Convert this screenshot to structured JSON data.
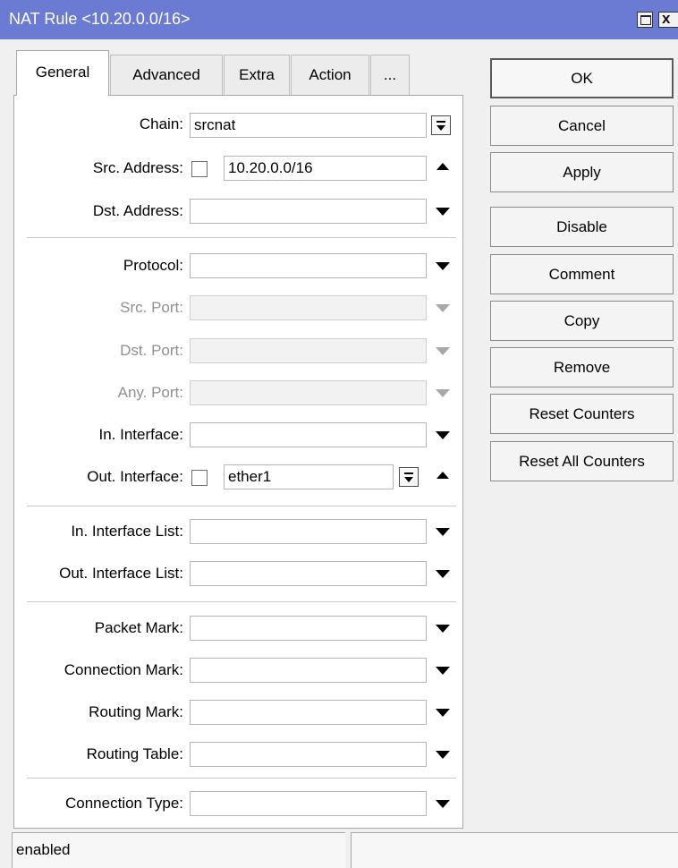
{
  "window": {
    "title": "NAT Rule <10.20.0.0/16>"
  },
  "tabs": [
    {
      "label": "General",
      "active": true
    },
    {
      "label": "Advanced",
      "active": false
    },
    {
      "label": "Extra",
      "active": false
    },
    {
      "label": "Action",
      "active": false
    },
    {
      "label": "...",
      "active": false
    }
  ],
  "fields": {
    "chain": {
      "label": "Chain:",
      "value": "srcnat"
    },
    "src_address": {
      "label": "Src. Address:",
      "value": "10.20.0.0/16"
    },
    "dst_address": {
      "label": "Dst. Address:",
      "value": ""
    },
    "protocol": {
      "label": "Protocol:",
      "value": ""
    },
    "src_port": {
      "label": "Src. Port:",
      "value": ""
    },
    "dst_port": {
      "label": "Dst. Port:",
      "value": ""
    },
    "any_port": {
      "label": "Any. Port:",
      "value": ""
    },
    "in_interface": {
      "label": "In. Interface:",
      "value": ""
    },
    "out_interface": {
      "label": "Out. Interface:",
      "value": "ether1"
    },
    "in_interface_list": {
      "label": "In. Interface List:",
      "value": ""
    },
    "out_interface_list": {
      "label": "Out. Interface List:",
      "value": ""
    },
    "packet_mark": {
      "label": "Packet Mark:",
      "value": ""
    },
    "connection_mark": {
      "label": "Connection Mark:",
      "value": ""
    },
    "routing_mark": {
      "label": "Routing Mark:",
      "value": ""
    },
    "routing_table": {
      "label": "Routing Table:",
      "value": ""
    },
    "connection_type": {
      "label": "Connection Type:",
      "value": ""
    }
  },
  "buttons": {
    "ok": "OK",
    "cancel": "Cancel",
    "apply": "Apply",
    "disable": "Disable",
    "comment": "Comment",
    "copy": "Copy",
    "remove": "Remove",
    "reset_counters": "Reset Counters",
    "reset_all_counters": "Reset All Counters"
  },
  "status": {
    "state": "enabled",
    "extra": ""
  },
  "colors": {
    "titlebar": "#6b7bd4",
    "panel": "#ffffff",
    "window_bg": "#f0f0f0"
  }
}
